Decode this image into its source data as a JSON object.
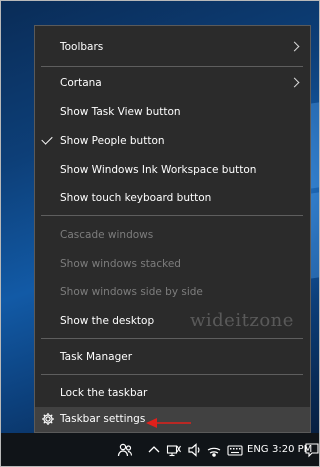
{
  "context_menu": {
    "toolbars": "Toolbars",
    "cortana": "Cortana",
    "show_task_view": "Show Task View button",
    "show_people": "Show People button",
    "show_ink_workspace": "Show Windows Ink Workspace button",
    "show_touch_keyboard": "Show touch keyboard button",
    "cascade_windows": "Cascade windows",
    "show_windows_stacked": "Show windows stacked",
    "show_windows_side_by_side": "Show windows side by side",
    "show_desktop": "Show the desktop",
    "task_manager": "Task Manager",
    "lock_taskbar": "Lock the taskbar",
    "taskbar_settings": "Taskbar settings"
  },
  "watermark": "wideitzone",
  "taskbar": {
    "language": "ENG",
    "time": "3:20 PM"
  },
  "colors": {
    "menu_background": "#2b2b2b",
    "disabled_text": "#7d7d7d",
    "highlight": "#414141",
    "annotation_arrow": "#e0201b"
  },
  "icons": [
    "chevron-right-icon",
    "checkmark-icon",
    "gear-icon",
    "people-icon",
    "chevron-up-icon",
    "network-icon",
    "volume-icon",
    "wifi-icon",
    "keyboard-icon",
    "notification-icon"
  ]
}
